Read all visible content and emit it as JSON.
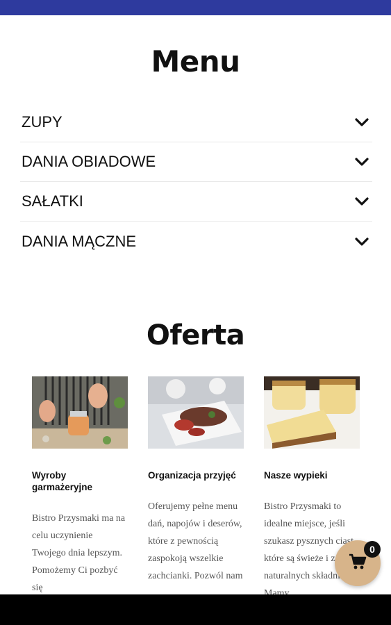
{
  "menu": {
    "title": "Menu",
    "items": [
      {
        "label": "ZUPY"
      },
      {
        "label": "DANIA OBIADOWE"
      },
      {
        "label": "SAŁATKI"
      },
      {
        "label": "DANIA MĄCZNE"
      }
    ]
  },
  "offer": {
    "title": "Oferta",
    "cards": [
      {
        "title": "Wyroby garmażeryjne",
        "text": "Bistro Przysmaki ma na celu uczynienie Twojego dnia lepszym. Pomożemy Ci pozbyć się"
      },
      {
        "title": "Organizacja przyjęć",
        "text": "Oferujemy pełne menu dań, napojów i deserów, które z pewnością zaspokoją wszelkie zachcianki. Pozwól nam"
      },
      {
        "title": "Nasze wypieki",
        "text": "Bistro Przysmaki to idealne miejsce, jeśli szukasz pysznych ciast, które są świeże i z naturalnych składników. Mamy"
      }
    ]
  },
  "cart": {
    "count": "0"
  },
  "colors": {
    "status_bar": "#2e3a9e",
    "cart_button": "#d7b48a",
    "badge": "#111111"
  }
}
